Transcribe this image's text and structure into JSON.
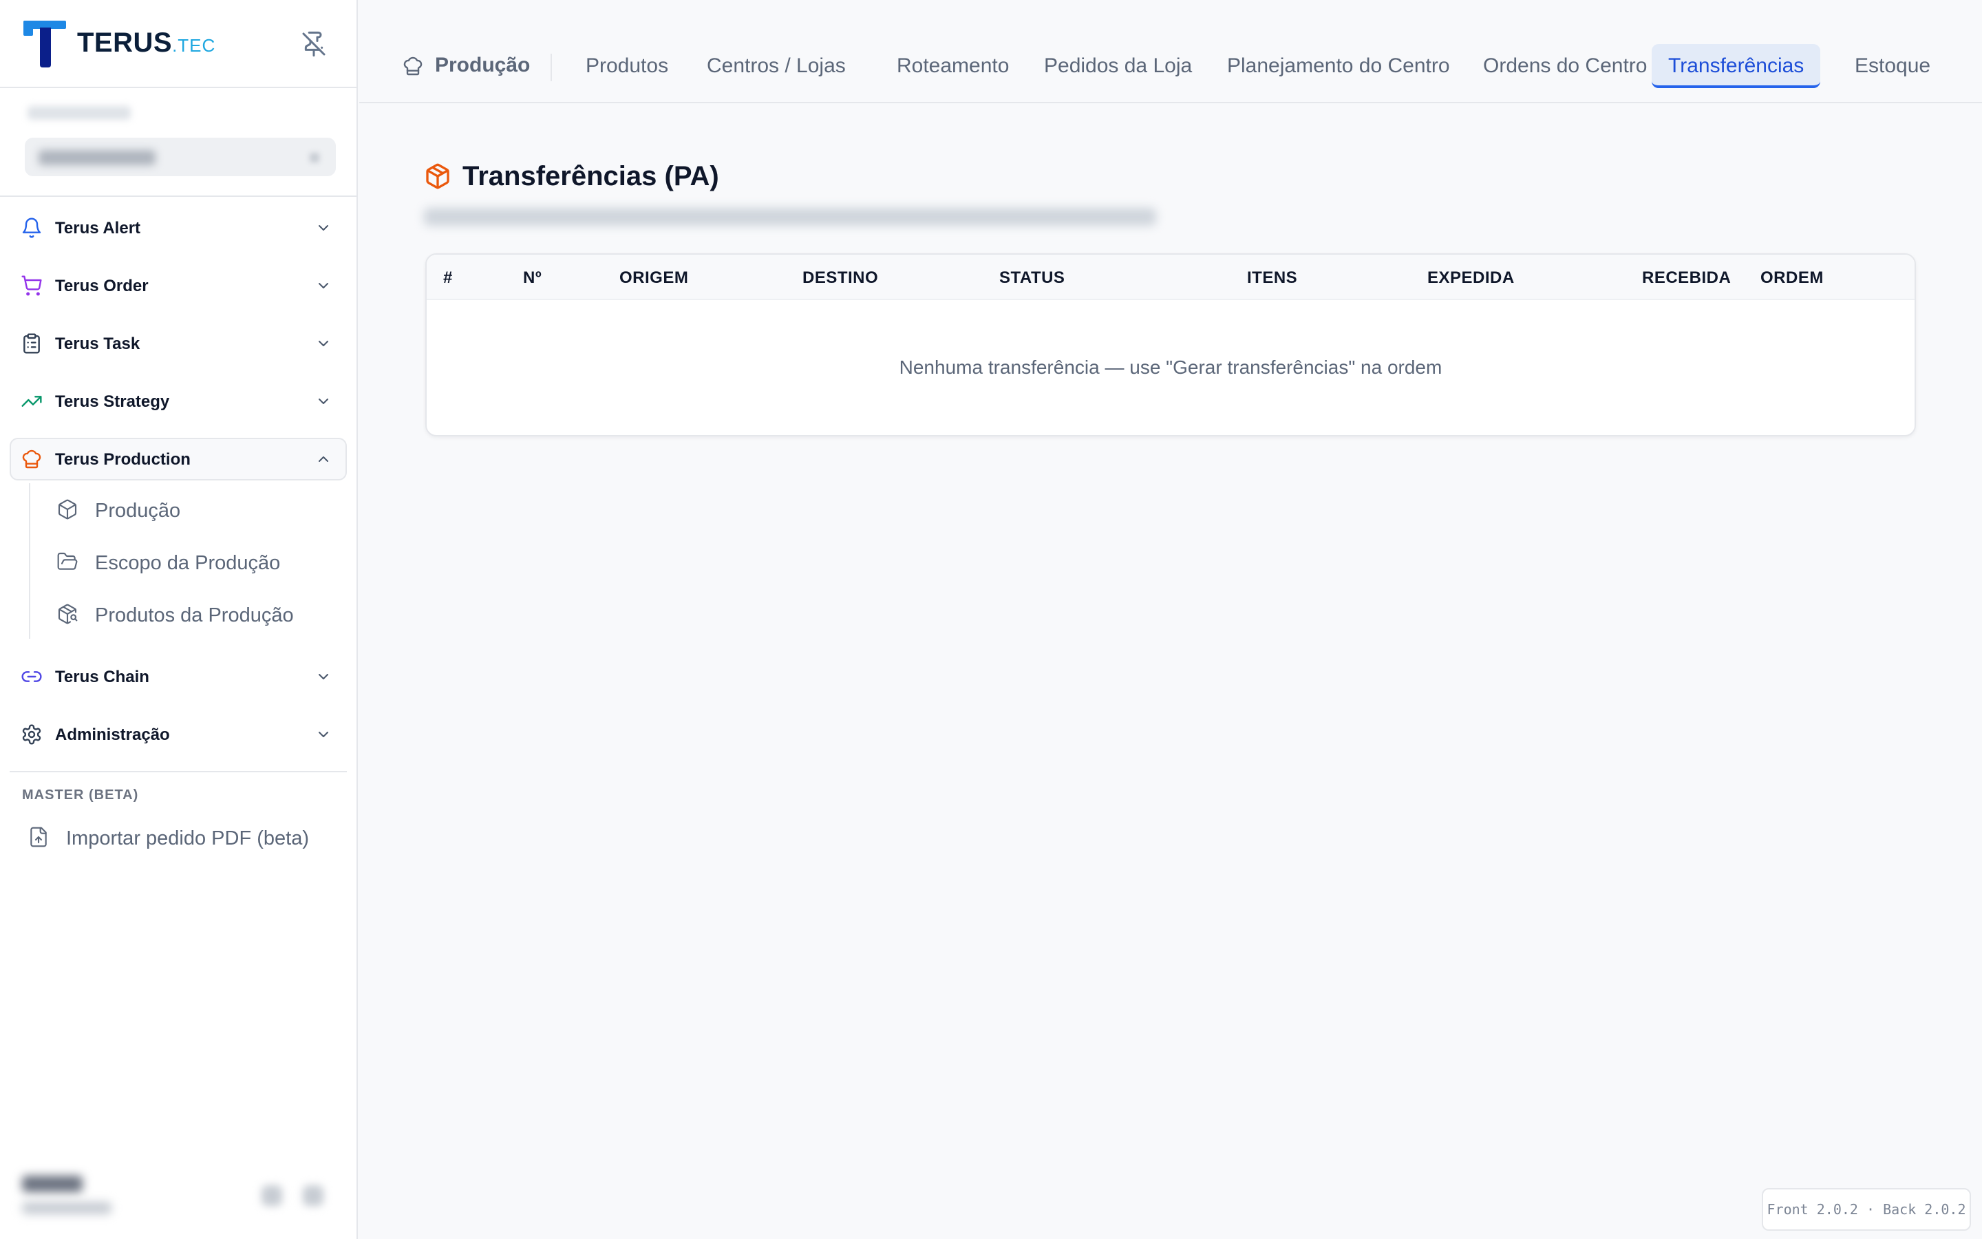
{
  "brand": {
    "name": "TERUS",
    "suffix": ".TEC"
  },
  "sidebar": {
    "items": [
      {
        "label": "Terus Alert",
        "icon": "bell-icon",
        "color": "#2563eb"
      },
      {
        "label": "Terus Order",
        "icon": "cart-icon",
        "color": "#9333ea"
      },
      {
        "label": "Terus Task",
        "icon": "clipboard-icon",
        "color": "#334155"
      },
      {
        "label": "Terus Strategy",
        "icon": "trending-up-icon",
        "color": "#059669"
      },
      {
        "label": "Terus Production",
        "icon": "chef-hat-icon",
        "color": "#ea580c",
        "expanded": true
      },
      {
        "label": "Terus Chain",
        "icon": "link-icon",
        "color": "#4f46e5"
      },
      {
        "label": "Administração",
        "icon": "gear-icon",
        "color": "#334155"
      }
    ],
    "production_sub": [
      {
        "label": "Produção",
        "icon": "box-icon"
      },
      {
        "label": "Escopo da Produção",
        "icon": "folder-open-icon"
      },
      {
        "label": "Produtos da Produção",
        "icon": "package-search-icon"
      }
    ],
    "section_label": "MASTER (BETA)",
    "import_pdf_label": "Importar pedido PDF (beta)"
  },
  "topnav": {
    "crumb": "Produção",
    "tabs": [
      "Produtos",
      "Centros / Lojas",
      "Roteamento",
      "Pedidos da Loja",
      "Planejamento do Centro",
      "Ordens do Centro",
      "Transferências",
      "Estoque"
    ],
    "active_tab": "Transferências"
  },
  "page": {
    "title": "Transferências (PA)",
    "title_icon_color": "#ea580c",
    "table": {
      "columns": [
        "#",
        "Nº",
        "ORIGEM",
        "DESTINO",
        "STATUS",
        "ITENS",
        "EXPEDIDA",
        "RECEBIDA",
        "ORDEM"
      ],
      "empty_message": "Nenhuma transferência — use \"Gerar transferências\" na ordem"
    }
  },
  "footer": {
    "version": "Front 2.0.2 · Back 2.0.2"
  }
}
